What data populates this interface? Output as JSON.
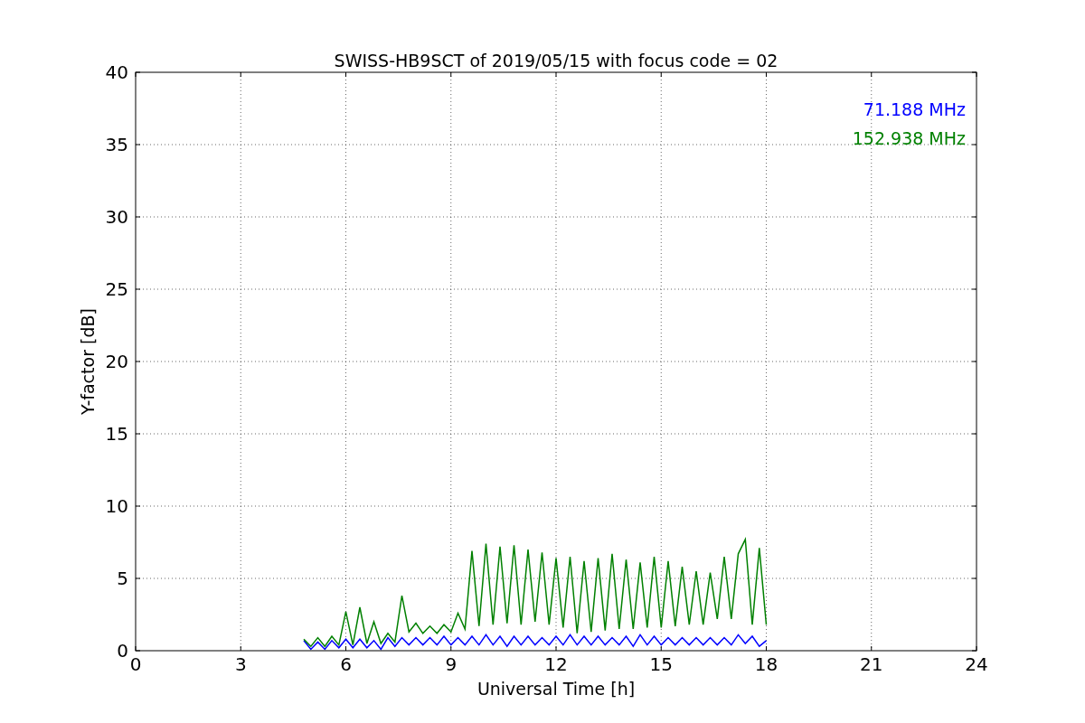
{
  "figure": {
    "chart_data": {
      "type": "line",
      "title": "SWISS-HB9SCT of 2019/05/15 with focus code = 02",
      "xlabel": "Universal Time [h]",
      "ylabel": "Y-factor [dB]",
      "x": [
        4.8,
        5.0,
        5.2,
        5.4,
        5.6,
        5.8,
        6.0,
        6.2,
        6.4,
        6.6,
        6.8,
        7.0,
        7.2,
        7.4,
        7.6,
        7.8,
        8.0,
        8.2,
        8.4,
        8.6,
        8.8,
        9.0,
        9.2,
        9.4,
        9.6,
        9.8,
        10.0,
        10.2,
        10.4,
        10.6,
        10.8,
        11.0,
        11.2,
        11.4,
        11.6,
        11.8,
        12.0,
        12.2,
        12.4,
        12.6,
        12.8,
        13.0,
        13.2,
        13.4,
        13.6,
        13.8,
        14.0,
        14.2,
        14.4,
        14.6,
        14.8,
        15.0,
        15.2,
        15.4,
        15.6,
        15.8,
        16.0,
        16.2,
        16.4,
        16.6,
        16.8,
        17.0,
        17.2,
        17.4,
        17.6,
        17.8,
        18.0
      ],
      "series": [
        {
          "name": "71.188 MHz",
          "color": "#0000ff",
          "values": [
            0.7,
            0.1,
            0.6,
            0.1,
            0.7,
            0.2,
            0.8,
            0.2,
            0.8,
            0.2,
            0.7,
            0.1,
            0.9,
            0.3,
            0.9,
            0.4,
            0.9,
            0.4,
            0.9,
            0.4,
            1.0,
            0.4,
            0.9,
            0.4,
            1.0,
            0.4,
            1.1,
            0.4,
            1.0,
            0.3,
            1.0,
            0.4,
            1.0,
            0.4,
            0.9,
            0.4,
            1.0,
            0.4,
            1.1,
            0.4,
            1.0,
            0.4,
            1.0,
            0.4,
            0.9,
            0.4,
            1.0,
            0.3,
            1.1,
            0.4,
            1.0,
            0.4,
            0.9,
            0.4,
            0.9,
            0.4,
            0.9,
            0.4,
            0.9,
            0.4,
            0.9,
            0.4,
            1.1,
            0.5,
            1.0,
            0.3,
            0.7
          ]
        },
        {
          "name": "152.938 MHz",
          "color": "#008000",
          "values": [
            0.8,
            0.3,
            0.9,
            0.3,
            1.0,
            0.4,
            2.7,
            0.4,
            3.0,
            0.5,
            2.0,
            0.5,
            1.2,
            0.6,
            3.8,
            1.3,
            1.9,
            1.2,
            1.7,
            1.2,
            1.8,
            1.3,
            2.6,
            1.5,
            6.9,
            1.7,
            7.4,
            1.8,
            7.2,
            1.9,
            7.3,
            1.8,
            7.0,
            2.0,
            6.8,
            1.8,
            6.4,
            1.6,
            6.5,
            1.2,
            6.2,
            1.3,
            6.4,
            1.4,
            6.7,
            1.5,
            6.3,
            1.5,
            6.1,
            1.6,
            6.5,
            1.6,
            6.2,
            1.7,
            5.8,
            1.8,
            5.5,
            1.8,
            5.4,
            2.2,
            6.5,
            2.2,
            6.7,
            7.7,
            1.8,
            7.1,
            1.8
          ]
        }
      ],
      "grid": true,
      "xlim": [
        0,
        24
      ],
      "ylim": [
        0,
        40
      ],
      "xticks": [
        0,
        3,
        6,
        9,
        12,
        15,
        18,
        21,
        24
      ],
      "yticks": [
        0,
        5,
        10,
        15,
        20,
        25,
        30,
        35,
        40
      ]
    }
  }
}
